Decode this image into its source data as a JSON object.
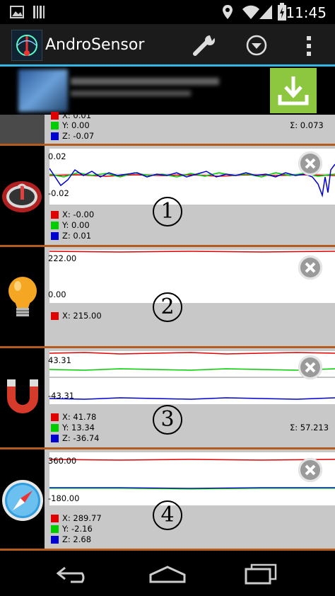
{
  "status_bar": {
    "time": "11:45"
  },
  "app": {
    "title": "AndroSensor"
  },
  "colors": {
    "x": "#e00000",
    "y": "#00cc00",
    "z": "#0000d0",
    "accent": "#33b5e5",
    "separator": "#b35c1e"
  },
  "top_partial": {
    "x_label": "X: 0.01",
    "y_label": "Y: 0.00",
    "z_label": "Z: -0.07",
    "sigma": "Σ: 0.073"
  },
  "sensors": [
    {
      "number": "1",
      "icon": "gyroscope-icon",
      "y_max": "0.02",
      "y_min": "-0.02",
      "x_label": "X: -0.00",
      "y_label": "Y: 0.00",
      "z_label": "Z: 0.01",
      "sigma": ""
    },
    {
      "number": "2",
      "icon": "light-bulb-icon",
      "y_max": "222.00",
      "y_min": "0.00",
      "x_label": "X: 215.00",
      "sigma": ""
    },
    {
      "number": "3",
      "icon": "magnet-icon",
      "y_max": "43.31",
      "y_min": "-43.31",
      "x_label": "X: 41.78",
      "y_label": "Y: 13.34",
      "z_label": "Z: -36.74",
      "sigma": "Σ: 57.213"
    },
    {
      "number": "4",
      "icon": "compass-icon",
      "y_max": "360.00",
      "y_min": "-180.00",
      "x_label": "X: 289.77",
      "y_label": "Y: -2.16",
      "z_label": "Z: 2.68",
      "sigma": ""
    }
  ]
}
